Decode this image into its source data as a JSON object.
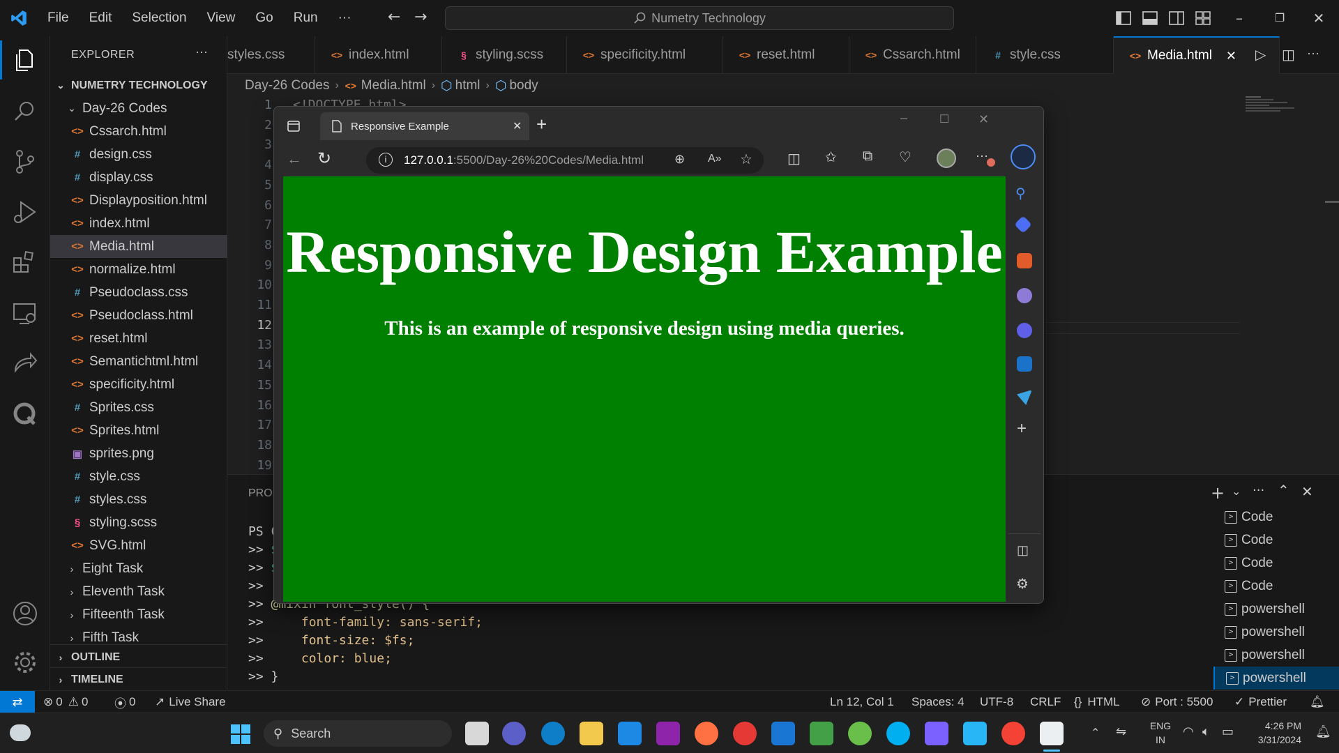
{
  "titlebar": {
    "menu": [
      "File",
      "Edit",
      "Selection",
      "View",
      "Go",
      "Run",
      "···"
    ],
    "search_text": "Numetry Technology"
  },
  "sidebar": {
    "header": "EXPLORER",
    "header_more": "···",
    "root": "NUMETRY TECHNOLOGY",
    "folder": "Day-26 Codes",
    "files": [
      {
        "name": "Cssarch.html",
        "type": "html"
      },
      {
        "name": "design.css",
        "type": "css"
      },
      {
        "name": "display.css",
        "type": "css"
      },
      {
        "name": "Displayposition.html",
        "type": "html"
      },
      {
        "name": "index.html",
        "type": "html"
      },
      {
        "name": "Media.html",
        "type": "html"
      },
      {
        "name": "normalize.html",
        "type": "html"
      },
      {
        "name": "Pseudoclass.css",
        "type": "css"
      },
      {
        "name": "Pseudoclass.html",
        "type": "html"
      },
      {
        "name": "reset.html",
        "type": "html"
      },
      {
        "name": "Semantichtml.html",
        "type": "html"
      },
      {
        "name": "specificity.html",
        "type": "html"
      },
      {
        "name": "Sprites.css",
        "type": "css"
      },
      {
        "name": "Sprites.html",
        "type": "html"
      },
      {
        "name": "sprites.png",
        "type": "png"
      },
      {
        "name": "style.css",
        "type": "css"
      },
      {
        "name": "styles.css",
        "type": "css"
      },
      {
        "name": "styling.scss",
        "type": "scss"
      },
      {
        "name": "SVG.html",
        "type": "html"
      }
    ],
    "collapsed_folders": [
      "Eight Task",
      "Eleventh Task",
      "Fifteenth Task",
      "Fifth Task"
    ],
    "outline": "OUTLINE",
    "timeline": "TIMELINE"
  },
  "tabs": [
    {
      "label": "styles.css",
      "type": "css"
    },
    {
      "label": "index.html",
      "type": "html"
    },
    {
      "label": "styling.scss",
      "type": "scss"
    },
    {
      "label": "specificity.html",
      "type": "html"
    },
    {
      "label": "reset.html",
      "type": "html"
    },
    {
      "label": "Cssarch.html",
      "type": "html"
    },
    {
      "label": "style.css",
      "type": "css"
    },
    {
      "label": "Media.html",
      "type": "html"
    }
  ],
  "breadcrumb": [
    "Day-26 Codes",
    "Media.html",
    "html",
    "body"
  ],
  "editor": {
    "line_numbers": [
      "1",
      "2",
      "3",
      "4",
      "5",
      "6",
      "7",
      "8",
      "9",
      "10",
      "11",
      "12",
      "13",
      "14",
      "15",
      "16",
      "17",
      "18",
      "19"
    ],
    "first_line_text": "<!DOCTYPE html>"
  },
  "panel": {
    "tab_label": "PROB",
    "terminal_lines": [
      {
        "prefix": "PS C",
        "text": ""
      },
      {
        "prefix": ">> ",
        "text": "$"
      },
      {
        "prefix": ">> ",
        "text": "$"
      },
      {
        "prefix": ">> ",
        "text": ""
      },
      {
        "prefix": ">> ",
        "text": "@mixin font_style() {"
      },
      {
        "prefix": ">> ",
        "text": "    font-family: sans-serif;"
      },
      {
        "prefix": ">> ",
        "text": "    font-size: $fs;"
      },
      {
        "prefix": ">> ",
        "text": "    color: blue;"
      },
      {
        "prefix": ">> ",
        "text": "}"
      }
    ],
    "terminals": [
      "Code",
      "Code",
      "Code",
      "Code",
      "powershell",
      "powershell",
      "powershell",
      "powershell"
    ]
  },
  "statusbar": {
    "errors": "0",
    "warnings": "0",
    "ports": "0",
    "live_share": "Live Share",
    "position": "Ln 12, Col 1",
    "spaces": "Spaces: 4",
    "encoding": "UTF-8",
    "eol": "CRLF",
    "language": "HTML",
    "port": "Port : 5500",
    "prettier": "Prettier"
  },
  "browser": {
    "tab_title": "Responsive Example",
    "url_host": "127.0.0.1",
    "url_path": ":5500/Day-26%20Codes/Media.html",
    "heading": "Responsive Design Example",
    "paragraph": "This is an example of responsive design using media queries.",
    "page_background": "#008000"
  },
  "taskbar": {
    "search_label": "Search",
    "lang_top": "ENG",
    "lang_bottom": "IN",
    "time": "4:26 PM",
    "date": "3/31/2024"
  }
}
